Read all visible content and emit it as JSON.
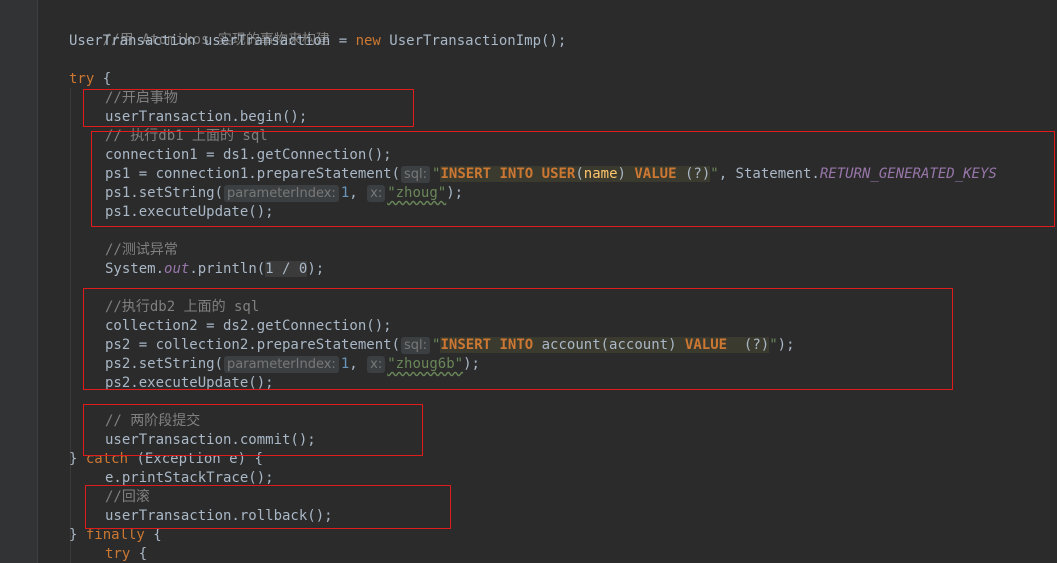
{
  "colors": {
    "background": "#2b2b2b",
    "keyword": "#cc7832",
    "string": "#6a8759",
    "number": "#6897bb",
    "comment": "#808080",
    "default_text": "#a9b7c6",
    "annotation_box": "#e01b1b"
  },
  "code": {
    "c_atomikos": "//用 Atomikos 实现的事物来构建",
    "ut_decl": "UserTransaction userTransaction = ",
    "kw_new": "new",
    "ut_impl": " UserTransactionImp();",
    "kw_try": "try",
    "brace_open": " {",
    "c_begin": "//开启事物",
    "begin_call": "userTransaction.begin();",
    "c_db1": "// 执行db1 上面的 sql",
    "conn1": "connection1 = ds1.getConnection();",
    "ps1_prefix": "ps1 = connection1.prepareStatement(",
    "hint_sql": "sql:",
    "sql1_quote_open": "\"",
    "sql1_insert": "INSERT INTO",
    "sql1_sp1": " ",
    "sql1_user": "USER",
    "sql1_paren_open": "(",
    "sql1_name": "name",
    "sql1_paren_close": ") ",
    "sql1_value": "VALUE",
    "sql1_tail": " (?)",
    "sql1_quote_close": "\"",
    "ps1_sep": ", Statement.",
    "ps1_const": "RETURN_GENERATED_KEYS",
    "ps1_set_prefix": "ps1.setString(",
    "hint_param_index": "parameterIndex:",
    "arg_one": "1",
    "arg_sep": ", ",
    "hint_x": "x:",
    "str_zhoug": "\"zhoug\"",
    "set_end": ");",
    "ps1_exec": "ps1.executeUpdate();",
    "c_test_exc": "//测试异常",
    "sysout_prefix": "System.",
    "sysout_out": "out",
    "sysout_println": ".println(",
    "div_zero": "1 / 0",
    "sysout_end": ");",
    "c_db2": "//执行db2 上面的 sql",
    "conn2": "collection2 = ds2.getConnection();",
    "ps2_prefix": "ps2 = collection2.prepareStatement(",
    "sql2_quote_open": "\"",
    "sql2_insert": "INSERT INTO",
    "sql2_account": " account(account) ",
    "sql2_value": "VALUE",
    "sql2_tail": "  (?)",
    "sql2_quote_close": "\"",
    "ps2_end": ");",
    "ps2_set_prefix": "ps2.setString(",
    "str_zhoug6b": "\"zhoug6b\"",
    "ps2_exec": "ps2.executeUpdate();",
    "c_commit": "// 两阶段提交",
    "commit_call": "userTransaction.commit();",
    "close_brace": "} ",
    "kw_catch": "catch",
    "catch_args": " (Exception e) {",
    "print_trace": "e.printStackTrace();",
    "c_rollback": "//回滚",
    "rollback_call": "userTransaction.rollback();",
    "kw_finally": "finally"
  }
}
